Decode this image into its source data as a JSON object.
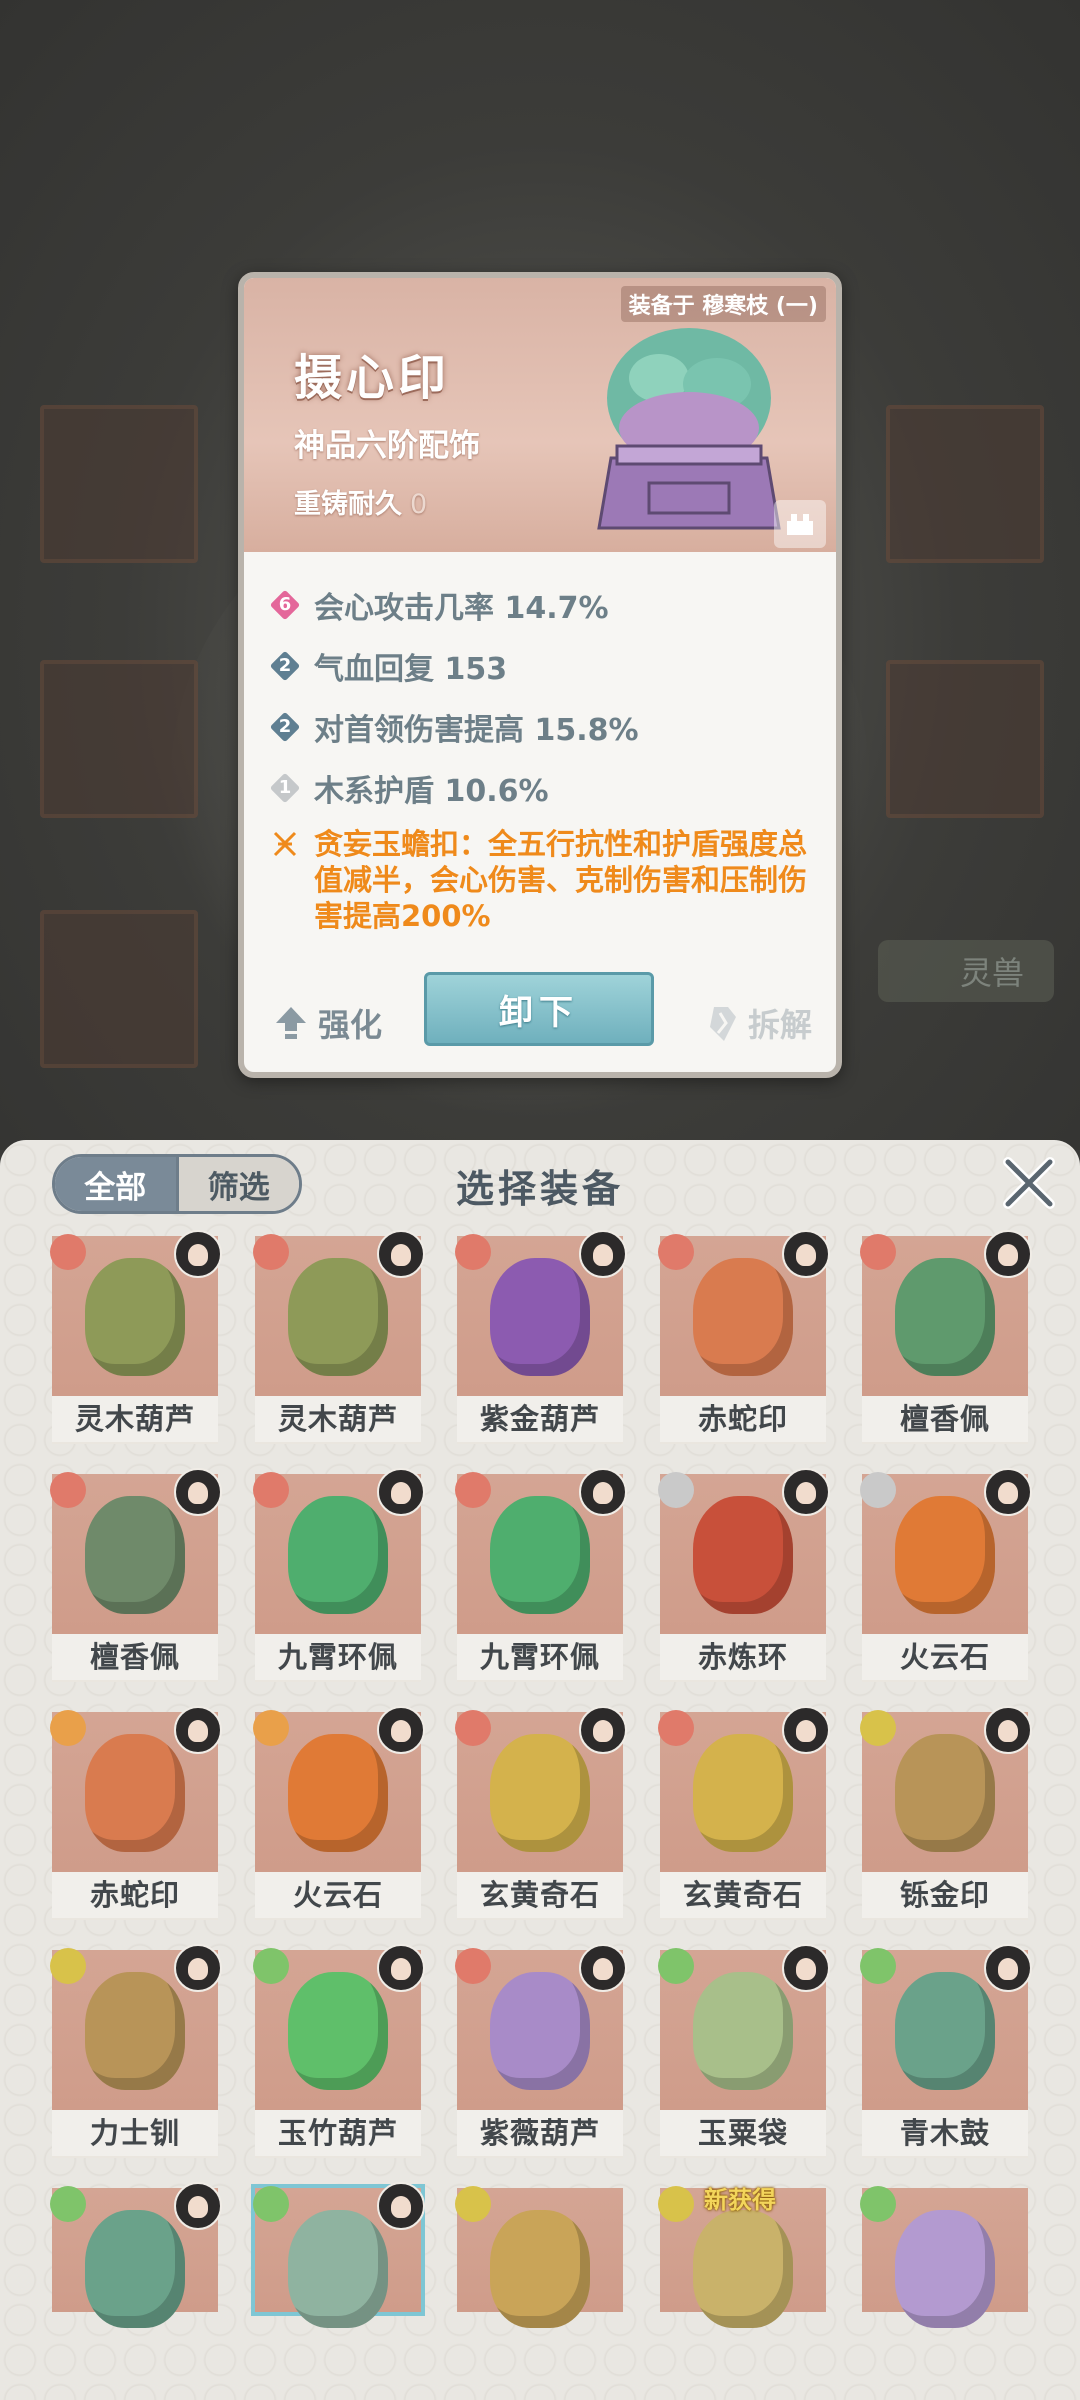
{
  "detail": {
    "equipped_on": "装备于 穆寒枝 (一)",
    "name": "摄心印",
    "type": "神品六阶配饰",
    "reforge_label": "重铸耐久",
    "reforge_value": "0",
    "stats": [
      {
        "tier": "6",
        "tier_color": "#e4679a",
        "text": "会心攻击几率 14.7%"
      },
      {
        "tier": "2",
        "tier_color": "#5f7f92",
        "text": "气血回复 153"
      },
      {
        "tier": "2",
        "tier_color": "#5f7f92",
        "text": "对首领伤害提高 15.8%"
      },
      {
        "tier": "1",
        "tier_color": "#c5c8ca",
        "text": "木系护盾 10.6%"
      }
    ],
    "special_text": "贪妄玉蟾扣：全五行抗性和护盾强度总值减半，会心伤害、克制伤害和压制伤害提高200%",
    "btn_strengthen": "强化",
    "btn_unequip": "卸下",
    "btn_dismantle": "拆解"
  },
  "background": {
    "pill_label": "灵兽"
  },
  "panel": {
    "tab_all": "全部",
    "tab_filter": "筛选",
    "title": "选择装备",
    "items": [
      {
        "name": "灵木葫芦",
        "elem": "#e07a6a",
        "art": "#8e9a58"
      },
      {
        "name": "灵木葫芦",
        "elem": "#e07a6a",
        "art": "#8e9a58"
      },
      {
        "name": "紫金葫芦",
        "elem": "#e07a6a",
        "art": "#8c5bb0"
      },
      {
        "name": "赤蛇印",
        "elem": "#e07a6a",
        "art": "#d97b4f"
      },
      {
        "name": "檀香佩",
        "elem": "#e07a6a",
        "art": "#5f9a6d"
      },
      {
        "name": "檀香佩",
        "elem": "#e07a6a",
        "art": "#6f8a6a"
      },
      {
        "name": "九霄环佩",
        "elem": "#e07a6a",
        "art": "#4fae6e"
      },
      {
        "name": "九霄环佩",
        "elem": "#e07a6a",
        "art": "#4fae6e"
      },
      {
        "name": "赤炼环",
        "elem": "#c9c9c9",
        "art": "#c8503a"
      },
      {
        "name": "火云石",
        "elem": "#c9c9c9",
        "art": "#e07a36"
      },
      {
        "name": "赤蛇印",
        "elem": "#e9a04a",
        "art": "#d97b4f"
      },
      {
        "name": "火云石",
        "elem": "#e9a04a",
        "art": "#e07a36"
      },
      {
        "name": "玄黄奇石",
        "elem": "#e07a6a",
        "art": "#d4b24c"
      },
      {
        "name": "玄黄奇石",
        "elem": "#e07a6a",
        "art": "#d4b24c"
      },
      {
        "name": "铄金印",
        "elem": "#d8c24a",
        "art": "#b89458"
      },
      {
        "name": "力士钏",
        "elem": "#d8c24a",
        "art": "#b89458"
      },
      {
        "name": "玉竹葫芦",
        "elem": "#7fc46a",
        "art": "#5fbf6a"
      },
      {
        "name": "紫薇葫芦",
        "elem": "#e07a6a",
        "art": "#a88bc8"
      },
      {
        "name": "玉粟袋",
        "elem": "#7fc46a",
        "art": "#a8bf8a"
      },
      {
        "name": "青木鼓",
        "elem": "#7fc46a",
        "art": "#6aa28a"
      }
    ],
    "row5": [
      {
        "elem": "#7fc46a",
        "art": "#6aa28a",
        "selected": false
      },
      {
        "elem": "#7fc46a",
        "art": "#8fb3a0",
        "selected": true
      },
      {
        "elem": "#d8c24a",
        "art": "#c9a458",
        "selected": false
      },
      {
        "elem": "#d8c24a",
        "art": "#c9b26a",
        "selected": false,
        "new_tag": "新获得"
      },
      {
        "elem": "#7fc46a",
        "art": "#b39ad0",
        "selected": false
      }
    ]
  }
}
